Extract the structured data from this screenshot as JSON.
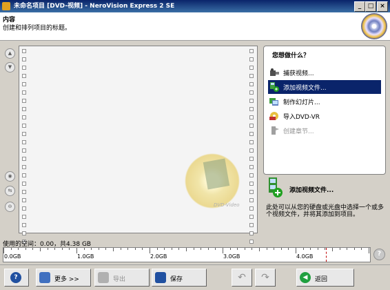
{
  "window": {
    "title": "未命名项目 [DVD-视频] - NeroVision Express 2 SE",
    "minimize": "_",
    "maximize": "□",
    "close": "×"
  },
  "header": {
    "title": "内容",
    "subtitle": "创建和排列项目的标题。"
  },
  "actions": {
    "title": "您想做什么？",
    "items": [
      {
        "label": "捕获视频...",
        "icon": "capture-video-icon",
        "state": "normal"
      },
      {
        "label": "添加视频文件...",
        "icon": "add-video-file-icon",
        "state": "selected"
      },
      {
        "label": "制作幻灯片...",
        "icon": "slideshow-icon",
        "state": "normal"
      },
      {
        "label": "导入DVD-VR",
        "icon": "import-dvd-vr-icon",
        "state": "normal"
      },
      {
        "label": "创建章节...",
        "icon": "chapter-icon",
        "state": "disabled"
      }
    ]
  },
  "description": {
    "title": "添加视频文件...",
    "text": "此处可以从您的硬盘或光盘中选择一个或多个视频文件，并将其添加到项目。"
  },
  "watermark": "DVD-Video",
  "space": {
    "label": "使用的空间：0.00，共4.38 GB"
  },
  "ruler": {
    "labels": [
      "0.0GB",
      "1.0GB",
      "2.0GB",
      "3.0GB",
      "4.0GB"
    ],
    "used_gb": 0.0,
    "capacity_gb": 4.38
  },
  "buttons": {
    "more": "更多 >>",
    "export": "导出",
    "save": "保存",
    "back": "返回"
  },
  "colors": {
    "selection": "#0a246a",
    "title_bar": "#0a246a",
    "limit_marker": "#c00000"
  }
}
